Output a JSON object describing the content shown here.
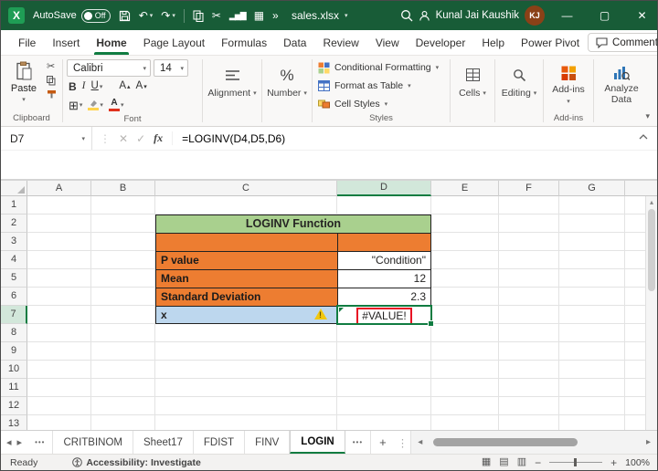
{
  "titlebar": {
    "app_name": "X",
    "autosave_label": "AutoSave",
    "autosave_state": "Off",
    "filename": "sales.xlsx",
    "user_name": "Kunal Jai Kaushik",
    "user_initials": "KJ"
  },
  "menubar": {
    "tabs": [
      "File",
      "Insert",
      "Home",
      "Page Layout",
      "Formulas",
      "Data",
      "Review",
      "View",
      "Developer",
      "Help",
      "Power Pivot"
    ],
    "active_tab": "Home",
    "comments_label": "Comments"
  },
  "ribbon": {
    "clipboard": {
      "paste": "Paste",
      "group_label": "Clipboard"
    },
    "font": {
      "font_name": "Calibri",
      "font_size": "14",
      "bold": "B",
      "italic": "I",
      "underline": "U",
      "color_letter": "A",
      "group_label": "Font"
    },
    "alignment": {
      "group_label": "Alignment"
    },
    "number": {
      "symbol": "%",
      "group_label": "Number"
    },
    "styles": {
      "conditional_formatting": "Conditional Formatting",
      "format_as_table": "Format as Table",
      "cell_styles": "Cell Styles",
      "group_label": "Styles"
    },
    "cells": {
      "group_label": "Cells"
    },
    "editing": {
      "group_label": "Editing"
    },
    "addins": {
      "label": "Add-ins",
      "group_label": "Add-ins"
    },
    "analyze": {
      "label": "Analyze Data"
    }
  },
  "formula_bar": {
    "name_box": "D7",
    "fx_label": "fx",
    "formula": "=LOGINV(D4,D5,D6)"
  },
  "sheet": {
    "columns": [
      "A",
      "B",
      "C",
      "D",
      "E",
      "F",
      "G"
    ],
    "selected_column": "D",
    "rows": [
      "1",
      "2",
      "3",
      "4",
      "5",
      "6",
      "7",
      "8",
      "9",
      "10",
      "11",
      "12",
      "13"
    ],
    "selected_row": "7",
    "table": {
      "title": "LOGINV Function",
      "rows": [
        {
          "label": "P value",
          "value": "\"Condition\""
        },
        {
          "label": "Mean",
          "value": "12"
        },
        {
          "label": "Standard Deviation",
          "value": "2.3"
        },
        {
          "label": "x",
          "value": "#VALUE!"
        }
      ]
    }
  },
  "tabs_bar": {
    "overflow": "•••",
    "tabs": [
      "CRITBINOM",
      "Sheet17",
      "FDIST",
      "FINV",
      "LOGIN"
    ],
    "active_tab": "LOGIN",
    "add_label": "+"
  },
  "status_bar": {
    "ready": "Ready",
    "accessibility": "Accessibility: Investigate",
    "zoom": "100%"
  }
}
